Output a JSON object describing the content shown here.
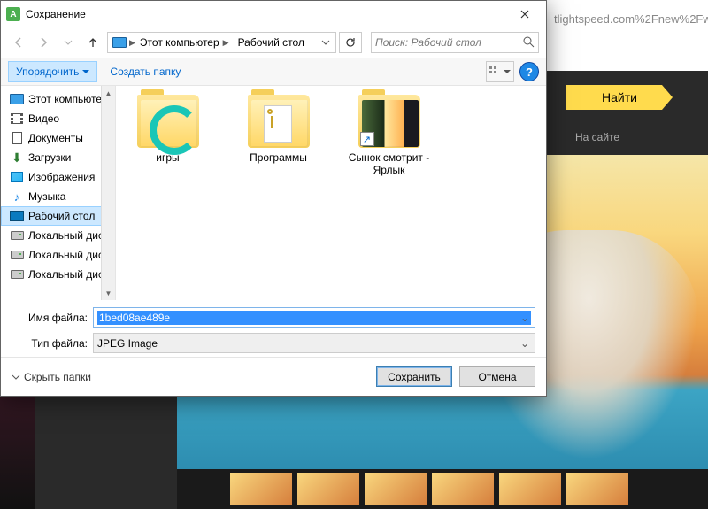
{
  "browser": {
    "url_fragment": "tlightspeed.com%2Fnew%2Fw",
    "find_button": "Найти",
    "site_label": "На сайте"
  },
  "dialog": {
    "title": "Сохранение",
    "breadcrumb": {
      "pc": "Этот компьютер",
      "desktop": "Рабочий стол"
    },
    "search_placeholder": "Поиск: Рабочий стол",
    "toolbar": {
      "organize": "Упорядочить",
      "new_folder": "Создать папку"
    },
    "tree": {
      "pc": "Этот компьютер",
      "video": "Видео",
      "documents": "Документы",
      "downloads": "Загрузки",
      "images": "Изображения",
      "music": "Музыка",
      "desktop": "Рабочий стол",
      "drive1": "Локальный диск",
      "drive2": "Локальный диск",
      "drive3": "Локальный диск"
    },
    "items": {
      "games": "игры",
      "programs": "Программы",
      "link": "Сынок смотрит - Ярлык"
    },
    "fields": {
      "filename_label": "Имя файла:",
      "filename_value": "1bed08ae489e",
      "filetype_label": "Тип файла:",
      "filetype_value": "JPEG Image"
    },
    "footer": {
      "hide_folders": "Скрыть папки",
      "save": "Сохранить",
      "cancel": "Отмена"
    }
  }
}
